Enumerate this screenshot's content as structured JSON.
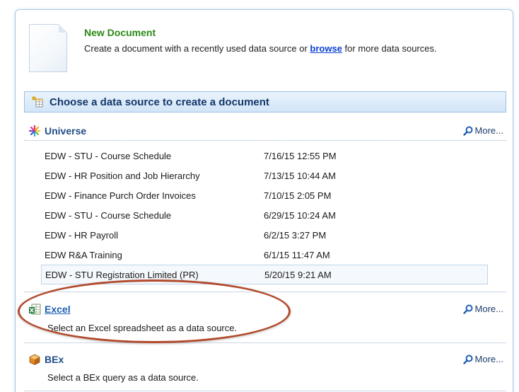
{
  "new_document": {
    "title": "New Document",
    "desc_before": "Create a document with a recently used data source or ",
    "browse_link": "browse",
    "desc_after": " for more data sources."
  },
  "choose_bar": {
    "title": "Choose a data source to create a document"
  },
  "universe": {
    "name": "Universe",
    "more_label": "More...",
    "items": [
      {
        "name": "EDW - STU - Course Schedule",
        "time": "7/16/15 12:55 PM"
      },
      {
        "name": "EDW - HR Position and Job Hierarchy",
        "time": "7/13/15 10:44 AM"
      },
      {
        "name": "EDW - Finance Purch Order Invoices",
        "time": "7/10/15 2:05 PM"
      },
      {
        "name": "EDW - STU - Course Schedule",
        "time": "6/29/15 10:24 AM"
      },
      {
        "name": "EDW - HR Payroll",
        "time": "6/2/15 3:27 PM"
      },
      {
        "name": "EDW R&A Training",
        "time": "6/1/15 11:47 AM"
      },
      {
        "name": "EDW - STU Registration Limited (PR)",
        "time": "5/20/15 9:21 AM"
      }
    ]
  },
  "excel": {
    "name": "Excel",
    "more_label": "More...",
    "desc": "Select an Excel spreadsheet as a data source."
  },
  "bex": {
    "name": "BEx",
    "more_label": "More...",
    "desc": "Select a BEx query as a data source."
  },
  "colors": {
    "title_green": "#2a8a16",
    "link_blue": "#0a3fd6",
    "bar_navy": "#13386b",
    "annotation_red": "#b24a2c"
  }
}
